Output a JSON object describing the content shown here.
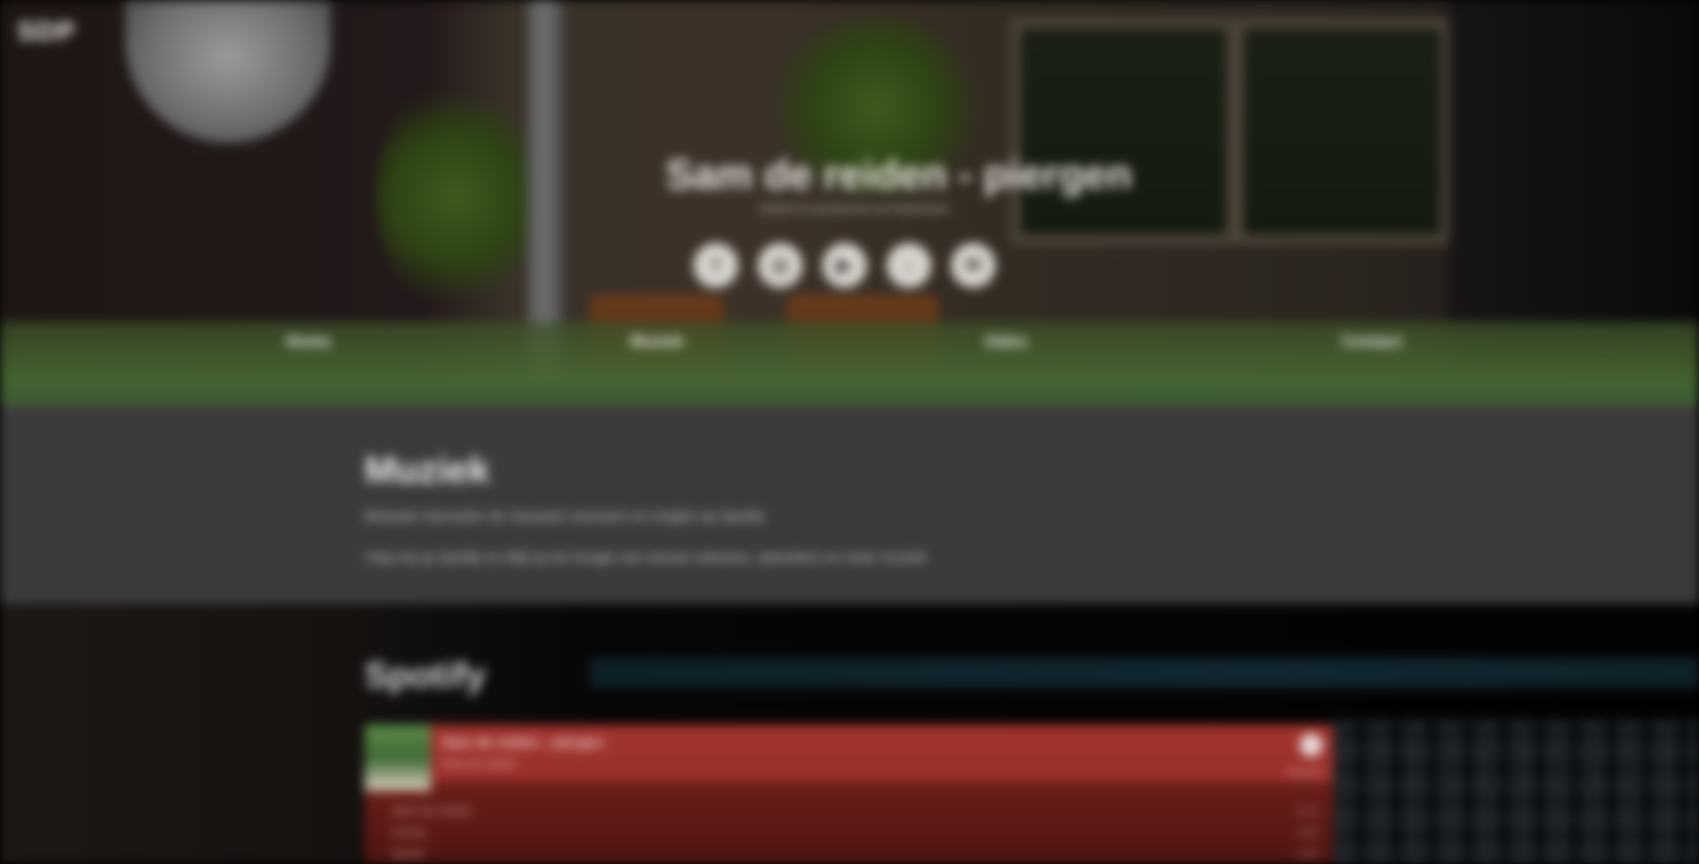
{
  "logo": {
    "text": "SDP"
  },
  "hero": {
    "title": "Sam de reiden - piergen",
    "subtitle": "Artiest en producent uit Nederland",
    "social_icons": [
      {
        "name": "facebook-icon",
        "glyph": "f"
      },
      {
        "name": "instagram-icon",
        "glyph": "◎"
      },
      {
        "name": "youtube-icon",
        "glyph": "▶"
      },
      {
        "name": "spotify-icon",
        "glyph": "♪"
      },
      {
        "name": "mail-icon",
        "glyph": "✉"
      }
    ],
    "nav": [
      {
        "label": "Home"
      },
      {
        "label": "Muziek"
      },
      {
        "label": "Video"
      },
      {
        "label": "Contact"
      }
    ]
  },
  "about": {
    "heading": "Muziek",
    "line1": "Beluister hieronder de nieuwste nummers en singles op Spotify",
    "line2": "Volg mij op Spotify en blijf op de hoogte van nieuwe releases, optredens en meer muziek"
  },
  "spotify": {
    "heading": "Spotify",
    "player": {
      "track_title": "Sam de reiden - piergen",
      "track_artist": "Sam de reiden",
      "preview_label": "Preview",
      "tracks": [
        {
          "title": "Sam de reiden",
          "duration": "3:12"
        },
        {
          "title": "Zomer",
          "duration": "2:58"
        },
        {
          "title": "Nacht",
          "duration": "3:40"
        }
      ]
    }
  },
  "colors": {
    "accent_green": "#3f5e32",
    "about_bg": "#3b3b3b",
    "player_red": "#a2342e"
  }
}
